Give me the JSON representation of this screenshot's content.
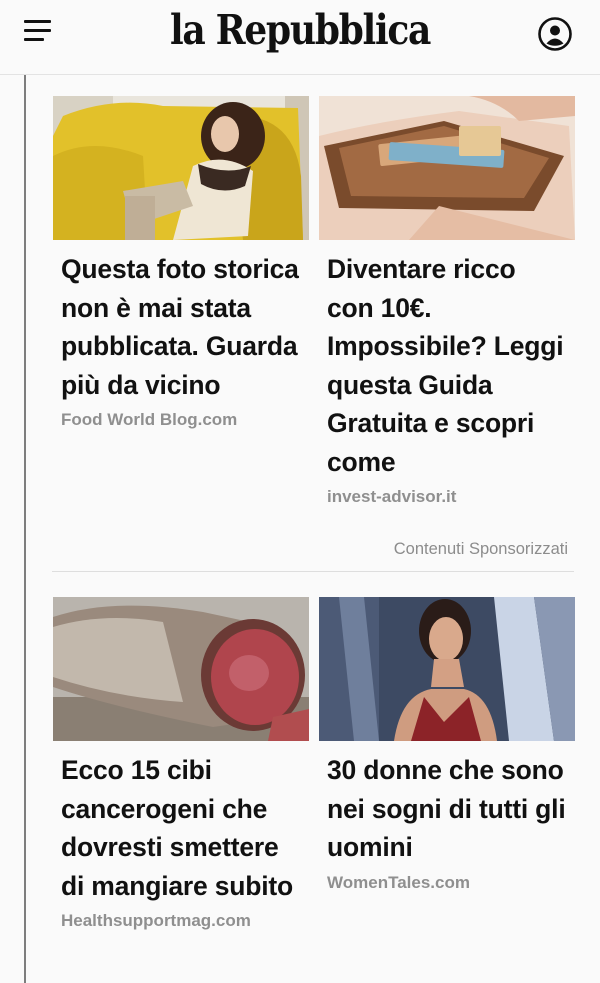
{
  "header": {
    "logo": "la Repubblica",
    "menu_icon": "hamburger-menu-icon",
    "user_icon": "user-account-icon"
  },
  "cards": [
    {
      "headline": "Questa foto storica non è mai stata pubblicata. Guarda più da vicino",
      "source": "Food World Blog.com",
      "image": "woman-on-yellow-armchair-photo"
    },
    {
      "headline": "Diventare ricco con 10€. Impossibile? Leggi questa Guida Gratuita e scopri come",
      "source": "invest-advisor.it",
      "image": "wallet-with-euro-banknotes-photo"
    },
    {
      "headline": "Ecco 15 cibi cancerogeni che dovresti smettere di mangiare subito",
      "source": "Healthsupportmag.com",
      "image": "cured-meat-salami-photo"
    },
    {
      "headline": "30 donne che sono nei sogni di tutti gli uomini",
      "source": "WomenTales.com",
      "image": "woman-red-dress-event-photo"
    }
  ],
  "sponsored_label": "Contenuti Sponsorizzati",
  "colors": {
    "background": "#fafafa",
    "source_text": "#8f8f8f",
    "sidebar_line": "#7d7d7d"
  }
}
